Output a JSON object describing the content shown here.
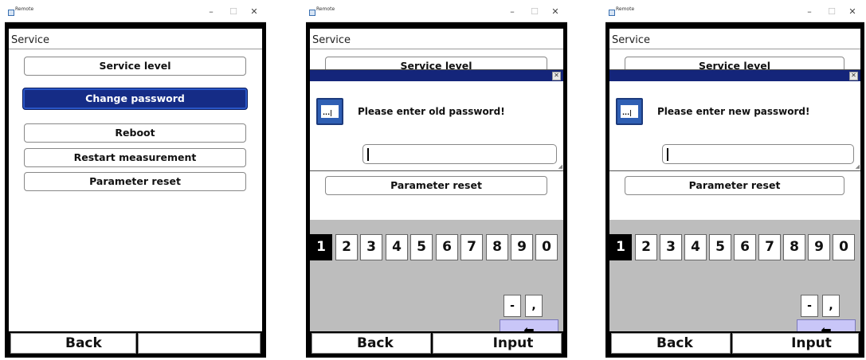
{
  "window": {
    "title": "Remote",
    "min": "–",
    "max": "☐",
    "close": "✕"
  },
  "screen_title": "Service",
  "menu": {
    "service_level": "Service level",
    "change_password": "Change password",
    "reboot": "Reboot",
    "restart_measurement": "Restart measurement",
    "parameter_reset": "Parameter reset"
  },
  "dialogs": {
    "old_password": "Please enter old password!",
    "new_password": "Please enter new password!",
    "icon_glyph": "...|",
    "close": "✕"
  },
  "keypad": {
    "digits": [
      "1",
      "2",
      "3",
      "4",
      "5",
      "6",
      "7",
      "8",
      "9",
      "0"
    ],
    "active_digit": "1",
    "minus": "-",
    "comma": ",",
    "backspace": "⬅"
  },
  "footer": {
    "back": "Back",
    "input": "Input"
  },
  "colors": {
    "selected": "#152c86",
    "dialog_bar": "#14257a",
    "keypad_bg": "#bdbdbd",
    "backspace": "#c9c6f8"
  }
}
